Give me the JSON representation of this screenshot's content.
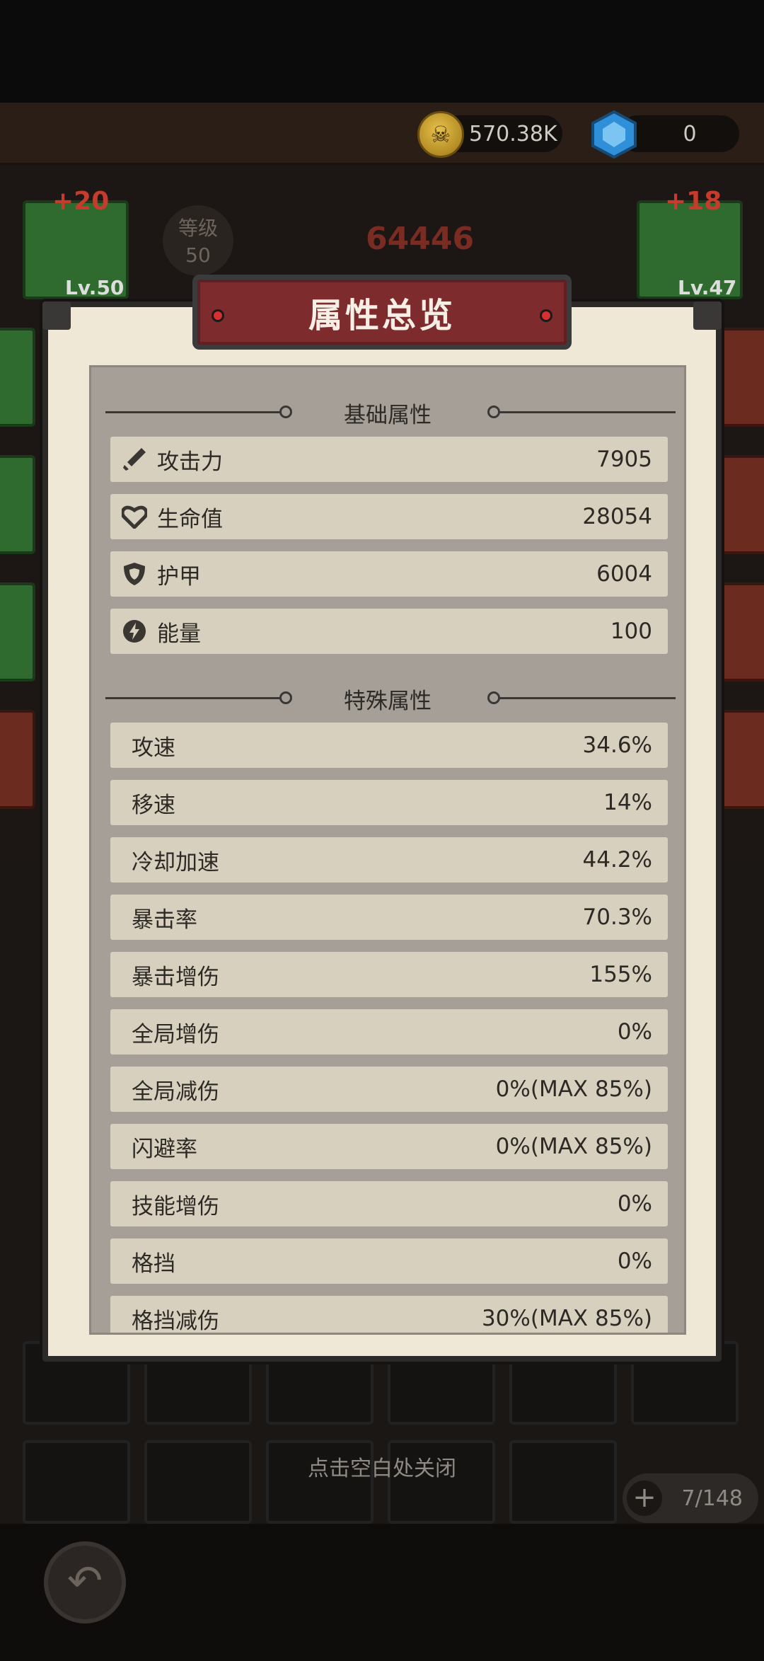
{
  "currency": {
    "coins": "570.38K",
    "gems": "0"
  },
  "hero": {
    "left_slot": {
      "plus": "+20",
      "level": "Lv.50"
    },
    "right_slot": {
      "plus": "+18",
      "level": "Lv.47"
    },
    "grade_label": "等级",
    "grade_value": "50",
    "power": "64446"
  },
  "modal": {
    "title": "属性总览",
    "basic_section": "基础属性",
    "basic_stats": [
      {
        "icon": "sword-icon",
        "name": "攻击力",
        "value": "7905"
      },
      {
        "icon": "heart-icon",
        "name": "生命值",
        "value": "28054"
      },
      {
        "icon": "shield-icon",
        "name": "护甲",
        "value": "6004"
      },
      {
        "icon": "lightning-icon",
        "name": "能量",
        "value": "100"
      }
    ],
    "special_section": "特殊属性",
    "special_stats": [
      {
        "name": "攻速",
        "value": "34.6%"
      },
      {
        "name": "移速",
        "value": "14%"
      },
      {
        "name": "冷却加速",
        "value": "44.2%"
      },
      {
        "name": "暴击率",
        "value": "70.3%"
      },
      {
        "name": "暴击增伤",
        "value": "155%"
      },
      {
        "name": "全局增伤",
        "value": "0%"
      },
      {
        "name": "全局减伤",
        "value": "0%(MAX 85%)"
      },
      {
        "name": "闪避率",
        "value": "0%(MAX 85%)"
      },
      {
        "name": "技能增伤",
        "value": "0%"
      },
      {
        "name": "格挡",
        "value": "0%"
      },
      {
        "name": "格挡减伤",
        "value": "30%(MAX 85%)"
      }
    ]
  },
  "close_hint": "点击空白处关闭",
  "bag": {
    "count": "7/148"
  },
  "colors": {
    "modal_bg": "#f0e8d6",
    "row_bg": "#d8d0bf",
    "banner": "#7e2b2d",
    "panel": "#a59f98"
  }
}
